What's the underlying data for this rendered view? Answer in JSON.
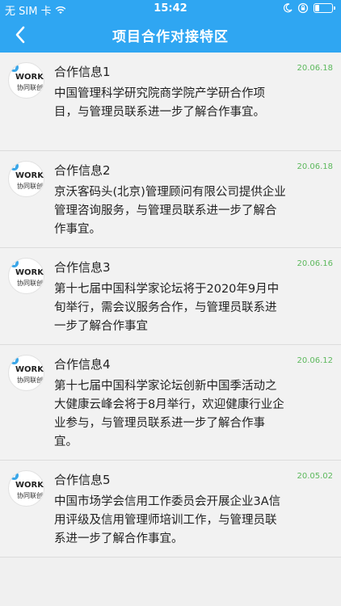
{
  "status_bar": {
    "carrier": "无 SIM 卡",
    "time": "15:42"
  },
  "nav": {
    "title": "项目合作对接特区",
    "back_icon": "chevron-left-icon"
  },
  "avatar_logo": {
    "badge": "V",
    "top": "WORK",
    "bottom": "协同联创"
  },
  "items": [
    {
      "name": "合作信息1",
      "date": "20.06.18",
      "desc": "中国管理科学研究院商学院产学研合作项目，与管理员联系进一步了解合作事宜。"
    },
    {
      "name": "合作信息2",
      "date": "20.06.18",
      "desc": "京沃客码头(北京)管理顾问有限公司提供企业管理咨询服务，与管理员联系进一步了解合作事宜。"
    },
    {
      "name": "合作信息3",
      "date": "20.06.16",
      "desc": "第十七届中国科学家论坛将于2020年9月中旬举行，需会议服务合作，与管理员联系进一步了解合作事宜"
    },
    {
      "name": "合作信息4",
      "date": "20.06.12",
      "desc": "第十七届中国科学家论坛创新中国季活动之大健康云峰会将于8月举行，欢迎健康行业企业参与，与管理员联系进一步了解合作事宜。"
    },
    {
      "name": "合作信息5",
      "date": "20.05.02",
      "desc": "中国市场学会信用工作委员会开展企业3A信用评级及信用管理师培训工作，与管理员联系进一步了解合作事宜。"
    }
  ]
}
